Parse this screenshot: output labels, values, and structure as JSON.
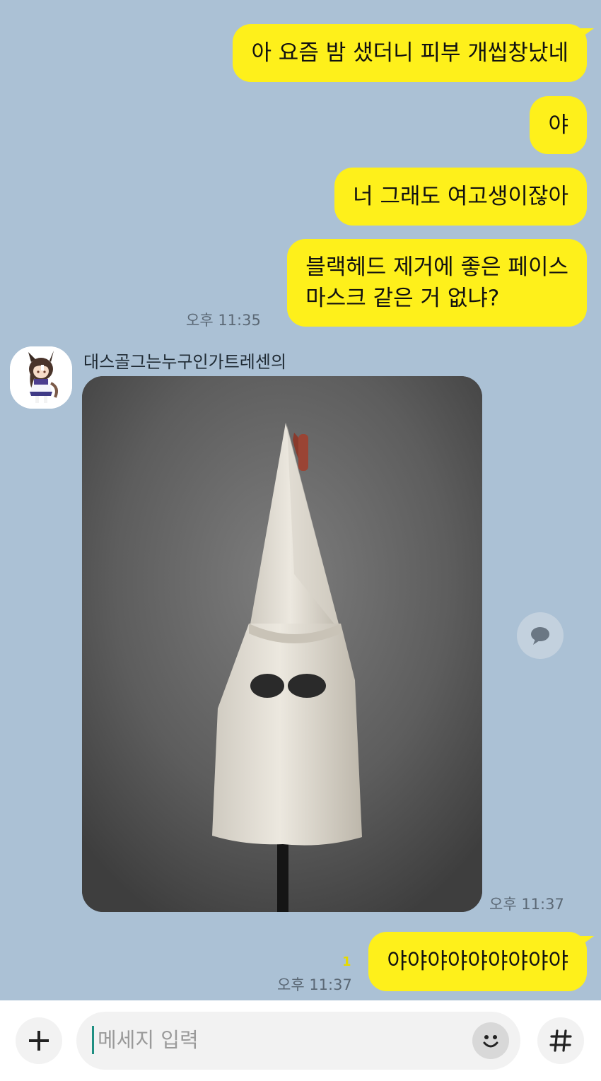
{
  "messages_me": [
    {
      "text": "아 요즘 밤 샜더니 피부 개씹창났네"
    },
    {
      "text": "야"
    },
    {
      "text": "너 그래도 여고생이잖아"
    },
    {
      "lines": [
        "블랙헤드 제거에 좋은 페이스",
        "마스크 같은 거 없냐?"
      ],
      "time": "오후 11:35"
    }
  ],
  "incoming": {
    "sender": "대스골그는누구인가트레센의",
    "avatar_icon": "anime-character-avatar",
    "image_description_icon": "white-hood-photo",
    "time": "오후 11:37"
  },
  "last_message": {
    "text": "야야야야야야야야야",
    "unread": "1",
    "time": "오후 11:37"
  },
  "input": {
    "placeholder": "메세지 입력"
  },
  "colors": {
    "background": "#abc1d5",
    "my_bubble": "#fef01b",
    "caret": "#1f8f82"
  }
}
